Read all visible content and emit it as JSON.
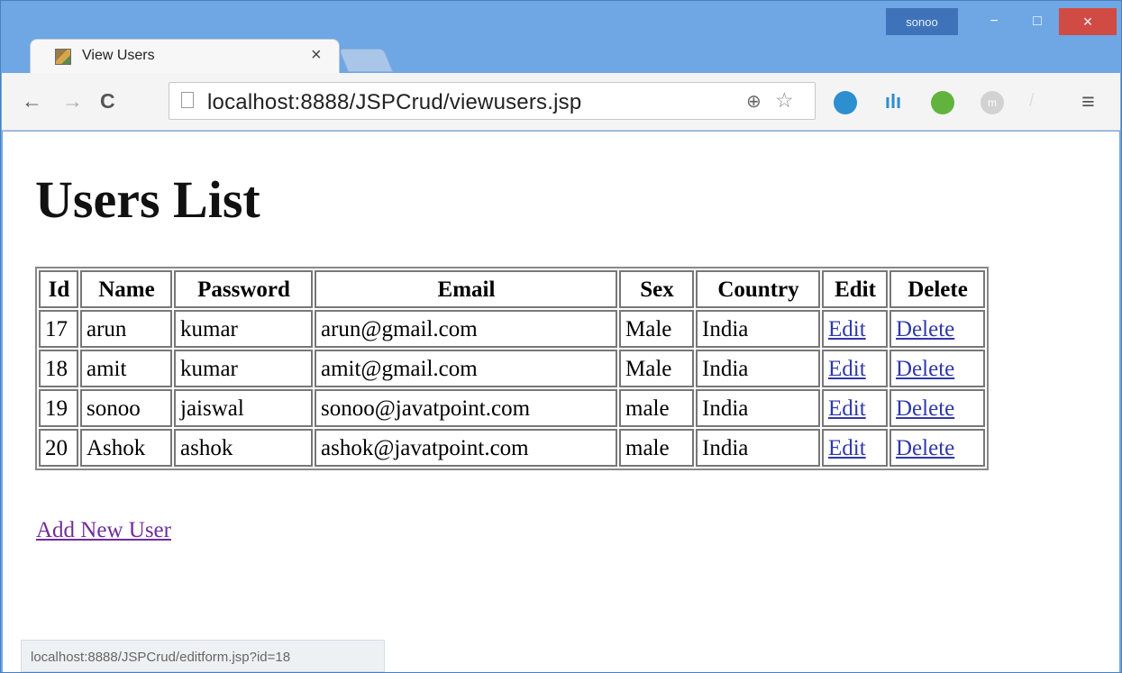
{
  "window": {
    "user_label": "sonoo",
    "minimize_symbol": "−",
    "maximize_symbol": "□",
    "close_symbol": "×"
  },
  "tab": {
    "title": "View Users",
    "close_symbol": "×"
  },
  "toolbar": {
    "back_symbol": "←",
    "forward_symbol": "→",
    "reload_symbol": "C",
    "url": "localhost:8888/JSPCrud/viewusers.jsp",
    "zoom_symbol": "⊕",
    "bookmark_symbol": "☆",
    "menu_symbol": "≡",
    "ext_m": "m"
  },
  "page": {
    "title": "Users List",
    "add_link": "Add New User"
  },
  "table": {
    "headers": [
      "Id",
      "Name",
      "Password",
      "Email",
      "Sex",
      "Country",
      "Edit",
      "Delete"
    ],
    "rows": [
      [
        "17",
        "arun",
        "kumar",
        "arun@gmail.com",
        "Male",
        "India",
        "Edit",
        "Delete"
      ],
      [
        "18",
        "amit",
        "kumar",
        "amit@gmail.com",
        "Male",
        "India",
        "Edit",
        "Delete"
      ],
      [
        "19",
        "sonoo",
        "jaiswal",
        "sonoo@javatpoint.com",
        "male",
        "India",
        "Edit",
        "Delete"
      ],
      [
        "20",
        "Ashok",
        "ashok",
        "ashok@javatpoint.com",
        "male",
        "India",
        "Edit",
        "Delete"
      ]
    ]
  },
  "status_bar": {
    "text": "localhost:8888/JSPCrud/editform.jsp?id=18"
  },
  "icons": {
    "tab_icon": "image-icon",
    "page_icon": "page-icon",
    "ext_1": "account-extension-icon",
    "ext_2": "chart-extension-icon",
    "ext_3": "wallet-extension-icon",
    "ext_4": "m-extension-icon",
    "ext_5": "slash-extension-icon"
  }
}
